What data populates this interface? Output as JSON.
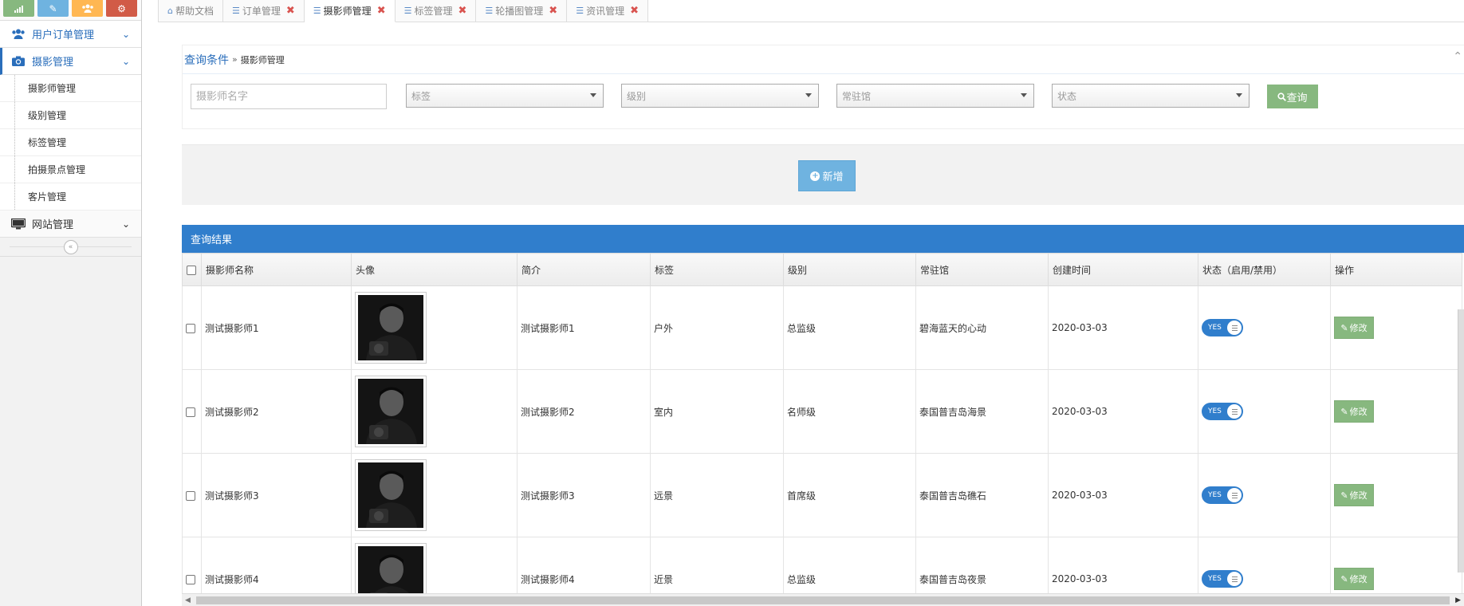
{
  "colors": {
    "primary": "#307ecc",
    "sidebar_accent": "#2a6ebb",
    "success": "#87b87f",
    "add": "#6fb3e0",
    "close": "#d9534f"
  },
  "shortcuts": [
    {
      "icon": "signal-icon",
      "color": "#87b87f"
    },
    {
      "icon": "pencil-icon",
      "color": "#6fb3e0"
    },
    {
      "icon": "users-icon",
      "color": "#ffb752"
    },
    {
      "icon": "cogs-icon",
      "color": "#d15b47"
    }
  ],
  "sidebar": {
    "order_mgmt": "用户订单管理",
    "photo_mgmt": "摄影管理",
    "sub_items": [
      "摄影师管理",
      "级别管理",
      "标签管理",
      "拍摄景点管理",
      "客片管理"
    ],
    "site_mgmt": "网站管理"
  },
  "tabs": [
    {
      "label": "帮助文档",
      "icon": "home-icon",
      "closable": false
    },
    {
      "label": "订单管理",
      "icon": "sliders-icon",
      "closable": true
    },
    {
      "label": "摄影师管理",
      "icon": "sliders-icon",
      "closable": true,
      "active": true
    },
    {
      "label": "标签管理",
      "icon": "sliders-icon",
      "closable": true
    },
    {
      "label": "轮播图管理",
      "icon": "sliders-icon",
      "closable": true
    },
    {
      "label": "资讯管理",
      "icon": "sliders-icon",
      "closable": true
    }
  ],
  "query": {
    "title": "查询条件",
    "separator": "»",
    "crumb": "摄影师管理",
    "name_placeholder": "摄影师名字",
    "tag_select": "标签",
    "level_select": "级别",
    "venue_select": "常驻馆",
    "status_select": "状态",
    "search_label": "查询"
  },
  "add_label": "新增",
  "results": {
    "title": "查询结果",
    "columns": [
      "摄影师名称",
      "头像",
      "简介",
      "标签",
      "级别",
      "常驻馆",
      "创建时间",
      "状态（启用/禁用）",
      "操作"
    ],
    "rows": [
      {
        "name": "测试摄影师1",
        "intro": "测试摄影师1",
        "tag": "户外",
        "level": "总监级",
        "venue": "碧海蓝天的心动",
        "created": "2020-03-03",
        "status": "YES",
        "action": "修改"
      },
      {
        "name": "测试摄影师2",
        "intro": "测试摄影师2",
        "tag": "室内",
        "level": "名师级",
        "venue": "泰国普吉岛海景",
        "created": "2020-03-03",
        "status": "YES",
        "action": "修改"
      },
      {
        "name": "测试摄影师3",
        "intro": "测试摄影师3",
        "tag": "远景",
        "level": "首席级",
        "venue": "泰国普吉岛礁石",
        "created": "2020-03-03",
        "status": "YES",
        "action": "修改"
      },
      {
        "name": "测试摄影师4",
        "intro": "测试摄影师4",
        "tag": "近景",
        "level": "总监级",
        "venue": "泰国普吉岛夜景",
        "created": "2020-03-03",
        "status": "YES",
        "action": "修改"
      }
    ]
  }
}
